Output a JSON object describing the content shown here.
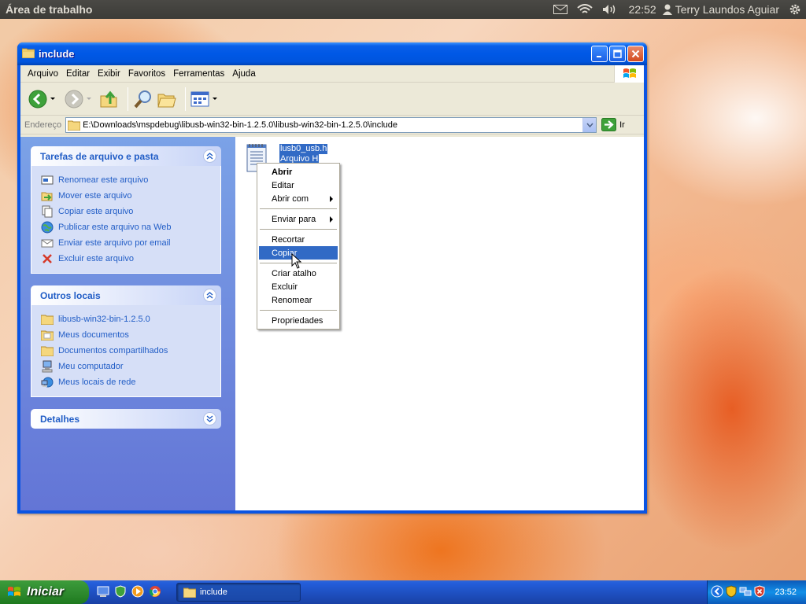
{
  "top_panel": {
    "title": "Área de trabalho",
    "clock": "22:52",
    "user": "Terry Laundos Aguiar",
    "icons": [
      "mail-icon",
      "wifi-icon",
      "volume-icon",
      "user-icon",
      "gear-icon"
    ]
  },
  "window": {
    "title": "include",
    "menu": [
      "Arquivo",
      "Editar",
      "Exibir",
      "Favoritos",
      "Ferramentas",
      "Ajuda"
    ],
    "toolbar": [
      "back-icon",
      "forward-icon",
      "up-folder-icon",
      "search-icon",
      "folders-icon",
      "views-icon"
    ],
    "address": {
      "label": "Endereço",
      "path": "E:\\Downloads\\mspdebug\\libusb-win32-bin-1.2.5.0\\libusb-win32-bin-1.2.5.0\\include",
      "go_label": "Ir"
    }
  },
  "left_pane": {
    "tasks": {
      "title": "Tarefas de arquivo e pasta",
      "items": [
        {
          "label": "Renomear este arquivo",
          "icon": "rename-icon"
        },
        {
          "label": "Mover este arquivo",
          "icon": "move-icon"
        },
        {
          "label": "Copiar este arquivo",
          "icon": "copy-icon"
        },
        {
          "label": "Publicar este arquivo na Web",
          "icon": "web-icon"
        },
        {
          "label": "Enviar este arquivo por email",
          "icon": "email-icon"
        },
        {
          "label": "Excluir este arquivo",
          "icon": "delete-icon"
        }
      ]
    },
    "other_places": {
      "title": "Outros locais",
      "items": [
        {
          "label": "libusb-win32-bin-1.2.5.0",
          "icon": "folder-icon"
        },
        {
          "label": "Meus documentos",
          "icon": "folder-icon"
        },
        {
          "label": "Documentos compartilhados",
          "icon": "folder-icon"
        },
        {
          "label": "Meu computador",
          "icon": "computer-icon"
        },
        {
          "label": "Meus locais de rede",
          "icon": "network-icon"
        }
      ]
    },
    "details": {
      "title": "Detalhes"
    }
  },
  "file": {
    "name": "lusb0_usb.h",
    "type": "Arquivo H"
  },
  "context_menu": {
    "items": [
      {
        "label": "Abrir",
        "bold": true
      },
      {
        "label": "Editar"
      },
      {
        "label": "Abrir com",
        "submenu": true
      },
      {
        "separator": true
      },
      {
        "label": "Enviar para",
        "submenu": true
      },
      {
        "separator": true
      },
      {
        "label": "Recortar"
      },
      {
        "label": "Copiar",
        "highlighted": true
      },
      {
        "separator": true
      },
      {
        "label": "Criar atalho"
      },
      {
        "label": "Excluir"
      },
      {
        "label": "Renomear"
      },
      {
        "separator": true
      },
      {
        "label": "Propriedades"
      }
    ]
  },
  "taskbar": {
    "start_label": "Iniciar",
    "task_label": "include",
    "clock": "23:52"
  },
  "colors": {
    "xp_blue": "#0a54e3",
    "selection": "#316ac5",
    "task_link": "#215dc6",
    "start_green": "#2f8b2f"
  }
}
